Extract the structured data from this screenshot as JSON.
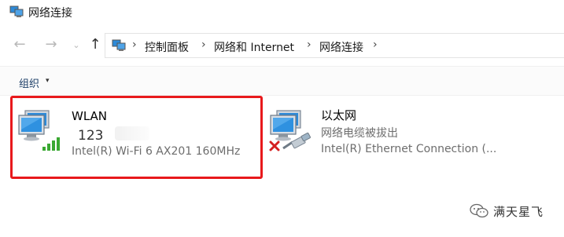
{
  "window": {
    "title": "网络连接"
  },
  "navigation": {
    "back_icon": "arrow-left-icon",
    "forward_icon": "arrow-right-icon",
    "recent_icon": "chevron-down-icon",
    "up_icon": "arrow-up-icon"
  },
  "breadcrumb": {
    "items": [
      "控制面板",
      "网络和 Internet",
      "网络连接"
    ],
    "separator": "›"
  },
  "toolbar": {
    "organize_label": "组织",
    "organize_caret": "▾"
  },
  "connections": [
    {
      "name": "WLAN",
      "status": "123",
      "description": "Intel(R) Wi-Fi 6 AX201 160MHz",
      "icon": "wifi-connected-icon",
      "selected_highlight": true
    },
    {
      "name": "以太网",
      "status": "网络电缆被拔出",
      "description": "Intel(R) Ethernet Connection (...",
      "icon": "ethernet-disconnected-icon"
    }
  ],
  "watermark": {
    "text": "满天星飞"
  },
  "colors": {
    "highlight_border": "#e8191c",
    "wifi_bars": "#3aa832",
    "disconnect_x": "#d42020",
    "monitor_blue": "#2d8ad8"
  }
}
